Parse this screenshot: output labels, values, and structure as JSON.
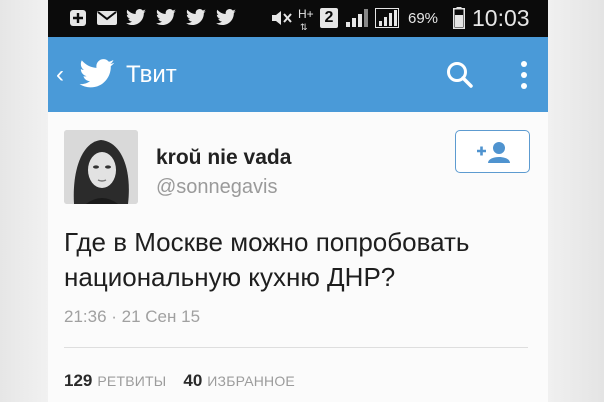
{
  "status_bar": {
    "network_type": "H+",
    "sim_slot": "2",
    "battery_percent": "69%",
    "time": "10:03"
  },
  "app_bar": {
    "title": "Твит",
    "back_icon": "chevron-left-icon",
    "logo_icon": "twitter-bird-icon",
    "actions": [
      "search-icon",
      "overflow-menu-icon"
    ]
  },
  "tweet": {
    "display_name": "kroŭ nie vada",
    "handle": "@sonnegavis",
    "follow_icon": "add-user-icon",
    "text": "Где в Москве можно попробовать национальную кухню ДНР?",
    "timestamp": "21:36 · 21 Сен 15",
    "retweets_count": "129",
    "retweets_label": "РЕТВИТЫ",
    "favorites_count": "40",
    "favorites_label": "ИЗБРАННОЕ"
  },
  "colors": {
    "app_bar": "#4a9ad8",
    "status_bar": "#0b0b0b",
    "follow_border": "#5d9bd0"
  }
}
